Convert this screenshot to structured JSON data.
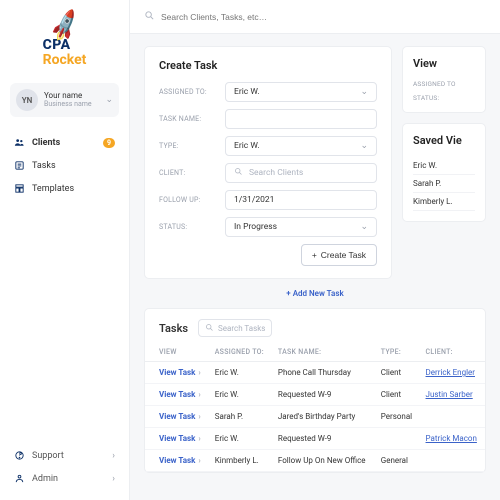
{
  "brand": {
    "top": "CPA",
    "bottom": "Rocket"
  },
  "user": {
    "initials": "YN",
    "name": "Your name",
    "business": "Business name"
  },
  "nav": {
    "clients": "Clients",
    "clients_badge": "9",
    "tasks": "Tasks",
    "templates": "Templates",
    "support": "Support",
    "admin": "Admin"
  },
  "search": {
    "placeholder": "Search Clients, Tasks, etc…"
  },
  "createTask": {
    "title": "Create Task",
    "labels": {
      "assigned": "ASSIGNED TO:",
      "taskname": "TASK NAME:",
      "type": "TYPE:",
      "client": "CLIENT:",
      "followup": "FOLLOW UP:",
      "status": "STATUS:"
    },
    "assigned_value": "Eric W.",
    "type_value": "Eric W.",
    "client_placeholder": "Search Clients",
    "followup_value": "1/31/2021",
    "status_value": "In Progress",
    "button": "Create Task"
  },
  "viewPanel": {
    "title": "View",
    "labels": {
      "assigned": "ASSIGNED TO",
      "status": "STATUS:"
    }
  },
  "savedViews": {
    "title": "Saved Vie",
    "items": [
      "Eric W.",
      "Sarah P.",
      "Kimberly L."
    ]
  },
  "addNew": "Add New Task",
  "tasks": {
    "title": "Tasks",
    "search_placeholder": "Search Tasks",
    "cols": {
      "view": "VIEW",
      "assigned": "ASSIGNED TO:",
      "name": "TASK NAME:",
      "type": "TYPE:",
      "client": "CLIENT:"
    },
    "view_label": "View Task",
    "rows": [
      {
        "assigned": "Eric W.",
        "name": "Phone Call Thursday",
        "type": "Client",
        "client": "Derrick Engler",
        "link": true
      },
      {
        "assigned": "Eric W.",
        "name": "Requested W-9",
        "type": "Client",
        "client": "Justin Sarber",
        "link": true
      },
      {
        "assigned": "Sarah P.",
        "name": "Jared's Birthday Party",
        "type": "Personal",
        "client": "",
        "link": false
      },
      {
        "assigned": "Eric W.",
        "name": "Requested W-9",
        "type": "",
        "client": "Patrick Macon",
        "link": true
      },
      {
        "assigned": "Kinmberly L.",
        "name": "Follow Up On New Office",
        "type": "General",
        "client": "",
        "link": false
      }
    ]
  }
}
